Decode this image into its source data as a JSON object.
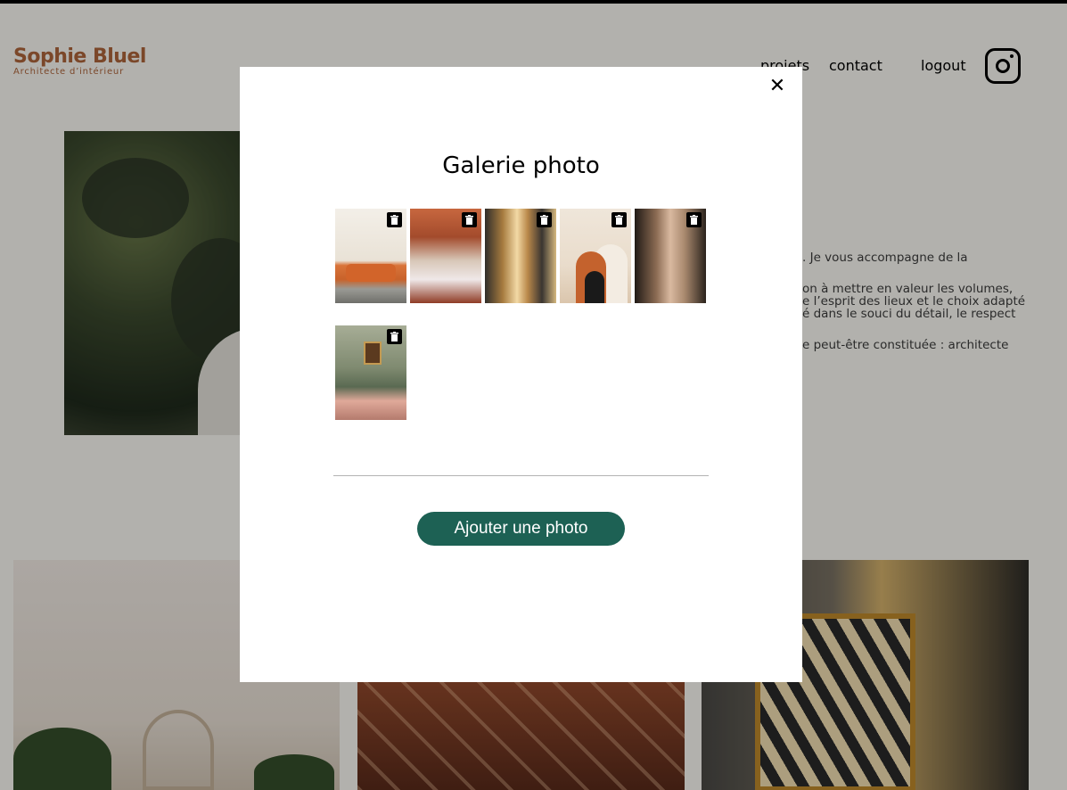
{
  "page": {
    "logo": {
      "name": "Sophie Bluel",
      "subtitle": "Architecte d’intérieur"
    },
    "nav": {
      "projects": "projets",
      "contact": "contact",
      "logout": "logout",
      "instagram_icon": "instagram-icon"
    },
    "intro_text": [
      ". Je vous accompagne de la",
      "on à mettre en valeur les volumes,",
      "e l’esprit des lieux et le choix adapté",
      "é dans le souci du détail, le respect",
      "e peut-être constituée : architecte"
    ]
  },
  "modal": {
    "title": "Galerie photo",
    "close_label": "✕",
    "thumbnails": [
      {
        "icon": "trash-icon"
      },
      {
        "icon": "trash-icon"
      },
      {
        "icon": "trash-icon"
      },
      {
        "icon": "trash-icon"
      },
      {
        "icon": "trash-icon"
      },
      {
        "icon": "trash-icon"
      }
    ],
    "add_button": "Ajouter une photo"
  },
  "colors": {
    "brand": "#b1663c",
    "button": "#1d6154",
    "overlay": "rgba(0,0,0,0.30)"
  }
}
